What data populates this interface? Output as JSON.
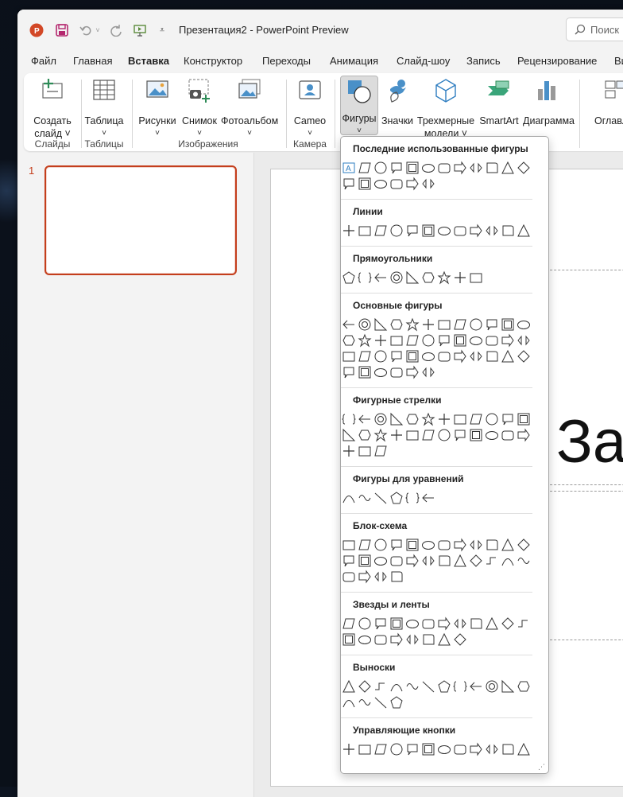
{
  "window": {
    "doc_title": "Презентация2  -  PowerPoint Preview",
    "search_placeholder": "Поиск"
  },
  "menu_tabs": [
    "Файл",
    "Главная",
    "Вставка",
    "Конструктор",
    "Переходы",
    "Анимация",
    "Слайд-шоу",
    "Запись",
    "Рецензирование",
    "Ви"
  ],
  "active_tab": "Вставка",
  "ribbon": {
    "new_slide": [
      "Создать",
      "слайд ˅"
    ],
    "table": [
      "Таблица",
      "˅"
    ],
    "pictures": [
      "Рисунки",
      "˅"
    ],
    "screenshot": [
      "Снимок",
      "˅"
    ],
    "photo_album": [
      "Фотоальбом",
      "˅"
    ],
    "cameo": [
      "Cameo",
      "˅"
    ],
    "shapes": [
      "Фигуры",
      "˅"
    ],
    "icons": "Значки",
    "models3d": [
      "Трехмерные",
      "модели ˅"
    ],
    "smartart": "SmartArt",
    "chart": "Диаграмма",
    "toc": "Оглавле",
    "groups": {
      "slides": "Слайды",
      "tables": "Таблицы",
      "images": "Изображения",
      "camera": "Камера"
    },
    "accent_color": "#c43e1c"
  },
  "thumbnails": [
    {
      "number": "1"
    }
  ],
  "slide": {
    "title_fragment": "За"
  },
  "shapes_gallery": {
    "sections": [
      {
        "title": "Последние использованные фигуры",
        "rows": [
          12,
          6
        ]
      },
      {
        "title": "Линии",
        "rows": [
          12
        ]
      },
      {
        "title": "Прямоугольники",
        "rows": [
          9
        ]
      },
      {
        "title": "Основные фигуры",
        "rows": [
          12,
          12,
          12,
          6
        ]
      },
      {
        "title": "Фигурные стрелки",
        "rows": [
          12,
          12,
          3
        ]
      },
      {
        "title": "Фигуры для уравнений",
        "rows": [
          6
        ]
      },
      {
        "title": "Блок-схема",
        "rows": [
          12,
          12,
          4
        ]
      },
      {
        "title": "Звезды и ленты",
        "rows": [
          12,
          8
        ]
      },
      {
        "title": "Выноски",
        "rows": [
          12,
          4
        ]
      },
      {
        "title": "Управляющие кнопки",
        "rows": [
          12
        ]
      }
    ],
    "basic_shape_numbers": [
      "7",
      "8",
      "10",
      "12"
    ]
  }
}
